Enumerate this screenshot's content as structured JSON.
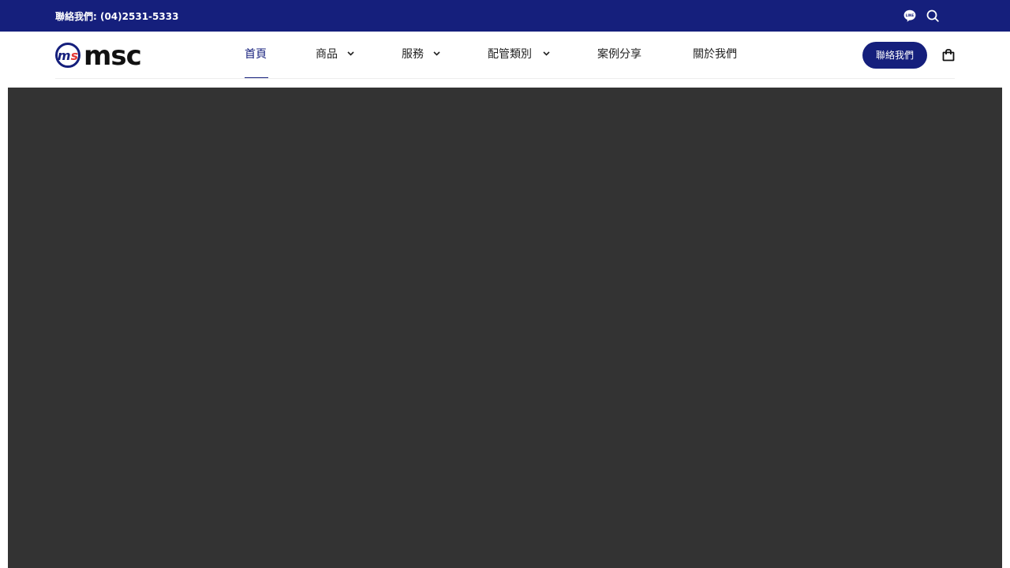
{
  "topbar": {
    "contact_text": "聯絡我們: (04)2531-5333",
    "icons": {
      "line": "line-app-icon",
      "search": "search-icon"
    }
  },
  "brand": {
    "logo_text": "msc",
    "badge_text": "ms"
  },
  "nav": {
    "items": [
      {
        "label": "首頁",
        "has_dropdown": false,
        "active": true
      },
      {
        "label": "商品",
        "has_dropdown": true,
        "active": false
      },
      {
        "label": "服務",
        "has_dropdown": true,
        "active": false
      },
      {
        "label": "配管類別",
        "has_dropdown": true,
        "active": false
      },
      {
        "label": "案例分享",
        "has_dropdown": false,
        "active": false
      },
      {
        "label": "關於我們",
        "has_dropdown": false,
        "active": false
      }
    ]
  },
  "header": {
    "cta_label": "聯絡我們",
    "cart_icon": "shopping-bag-icon"
  },
  "colors": {
    "brand_navy": "#151f7c",
    "brand_red": "#e53935",
    "hero_bg": "#333333"
  }
}
